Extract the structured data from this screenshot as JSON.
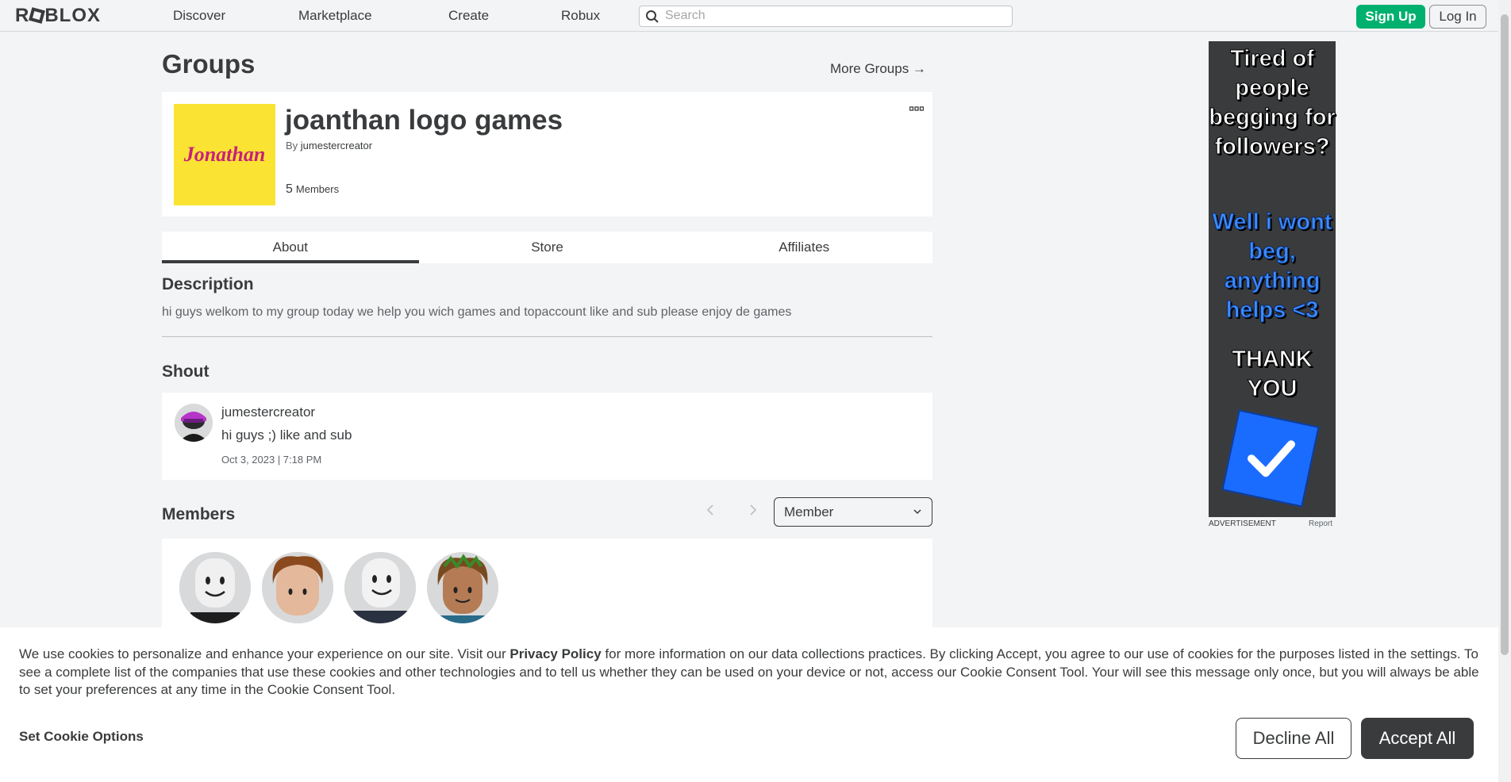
{
  "header": {
    "logo": "ROBLOX",
    "nav": [
      "Discover",
      "Marketplace",
      "Create",
      "Robux"
    ],
    "search_placeholder": "Search",
    "signup_label": "Sign Up",
    "login_label": "Log In"
  },
  "page": {
    "title": "Groups",
    "more_groups": "More Groups →"
  },
  "group": {
    "emblem_text": "Jonathan",
    "name": "joanthan logo games",
    "by_prefix": "By",
    "owner": "jumestercreator",
    "member_count": "5",
    "member_label": "Members"
  },
  "tabs": [
    "About",
    "Store",
    "Affiliates"
  ],
  "description": {
    "heading": "Description",
    "text": "hi guys welkom to my group today we help you wich games and topaccount like and sub please enjoy de games"
  },
  "shout": {
    "heading": "Shout",
    "user": "jumestercreator",
    "text": "hi guys ;) like and sub",
    "date": "Oct 3, 2023 | 7:18 PM"
  },
  "members": {
    "heading": "Members",
    "role_selected": "Member"
  },
  "ad": {
    "line1": "Tired of people begging for followers?",
    "line2": "Well i wont beg, anything helps <3",
    "line3": "THANK YOU",
    "label": "ADVERTISEMENT",
    "report": "Report"
  },
  "cookie": {
    "text_before": "We use cookies to personalize and enhance your experience on our site. Visit our ",
    "privacy_link": "Privacy Policy",
    "text_after": " for more information on our data collections practices. By clicking Accept, you agree to our use of cookies for the purposes listed in the settings. To see a complete list of the companies that use these cookies and other technologies and to tell us whether they can be used on your device or not, access our Cookie Consent Tool. Your will see this message only once, but you will always be able to set your preferences at any time in the Cookie Consent Tool.",
    "options_label": "Set Cookie Options",
    "decline_label": "Decline All",
    "accept_label": "Accept All"
  },
  "colors": {
    "signup_green": "#00b06f",
    "emblem_yellow": "#fbe333",
    "emblem_text": "#c8207a",
    "ad_blue": "#1a6cff"
  }
}
